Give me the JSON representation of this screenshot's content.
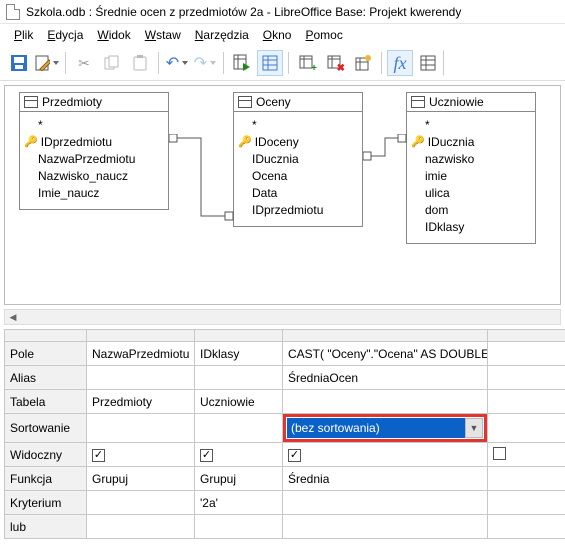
{
  "window": {
    "title": "Szkola.odb : Średnie ocen z przedmiotów 2a - LibreOffice Base: Projekt kwerendy"
  },
  "menu": {
    "items": [
      "Plik",
      "Edycja",
      "Widok",
      "Wstaw",
      "Narzędzia",
      "Okno",
      "Pomoc"
    ]
  },
  "tables": {
    "przedmioty": {
      "name": "Przedmioty",
      "star": "*",
      "fields": [
        "IDprzedmiotu",
        "NazwaPrzedmiotu",
        "Nazwisko_naucz",
        "Imie_naucz"
      ],
      "key_idx": 0
    },
    "oceny": {
      "name": "Oceny",
      "star": "*",
      "fields": [
        "IDoceny",
        "IDucznia",
        "Ocena",
        "Data",
        "IDprzedmiotu"
      ],
      "key_idx": 0
    },
    "uczniowie": {
      "name": "Uczniowie",
      "star": "*",
      "fields": [
        "IDucznia",
        "nazwisko",
        "imie",
        "ulica",
        "dom",
        "IDklasy"
      ],
      "key_idx": 0
    }
  },
  "grid": {
    "row_labels": {
      "field": "Pole",
      "alias": "Alias",
      "table": "Tabela",
      "sort": "Sortowanie",
      "visible": "Widoczny",
      "function": "Funkcja",
      "criterion": "Kryterium",
      "or": "lub"
    },
    "cols": [
      {
        "field": "NazwaPrzedmiotu",
        "alias": "",
        "table": "Przedmioty",
        "visible": true,
        "function": "Grupuj",
        "criterion": ""
      },
      {
        "field": "IDklasy",
        "alias": "",
        "table": "Uczniowie",
        "visible": true,
        "function": "Grupuj",
        "criterion": "'2a'"
      },
      {
        "field": "CAST( \"Oceny\".\"Ocena\" AS DOUBLE )",
        "alias": "ŚredniaOcen",
        "table": "",
        "visible": true,
        "function": "Średnia",
        "criterion": ""
      },
      {
        "field": "",
        "alias": "",
        "table": "",
        "visible": false,
        "function": "",
        "criterion": ""
      }
    ],
    "sort_value": "(bez sortowania)"
  }
}
